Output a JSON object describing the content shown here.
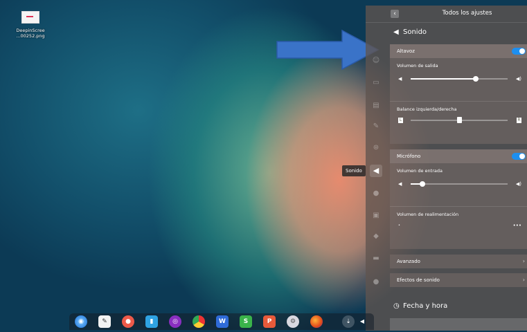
{
  "desktop": {
    "file_label": "DeepinScree\n...00252.png"
  },
  "panel": {
    "title": "Todos los ajustes",
    "back_glyph": "‹",
    "section_title": "Sonido",
    "speaker_card": {
      "header": "Altavoz",
      "enabled": true,
      "output_volume_label": "Volumen de salida",
      "output_volume_level": 0.67,
      "balance_label": "Balance izquierda/derecha",
      "balance_level": 0.5,
      "balance_left_glyph": "L",
      "balance_right_glyph": "R"
    },
    "mic_card": {
      "header": "Micrófono",
      "enabled": true,
      "input_volume_label": "Volumen de entrada",
      "input_volume_level": 0.12,
      "feedback_label": "Volumen de realimentación"
    },
    "advanced_label": "Avanzado",
    "effects_label": "Efectos de sonido",
    "next_section_title": "Fecha y hora"
  },
  "tooltip": "Sonido",
  "colors": {
    "accent": "#1d8ff0",
    "arrow": "#3a73c8"
  },
  "sidebar_icons": [
    "user-icon",
    "display-icon",
    "calendar-icon",
    "palette-icon",
    "network-icon",
    "sound-icon",
    "globe-icon",
    "keyboard-icon",
    "personalization-icon",
    "power-icon",
    "info-icon"
  ],
  "dock_icons": [
    "launcher-icon",
    "notes-icon",
    "screenshot-icon",
    "files-icon",
    "music-icon",
    "chrome-icon",
    "wps-writer-icon",
    "wps-spreadsheet-icon",
    "wps-presentation-icon",
    "settings-icon",
    "firefox-icon"
  ]
}
